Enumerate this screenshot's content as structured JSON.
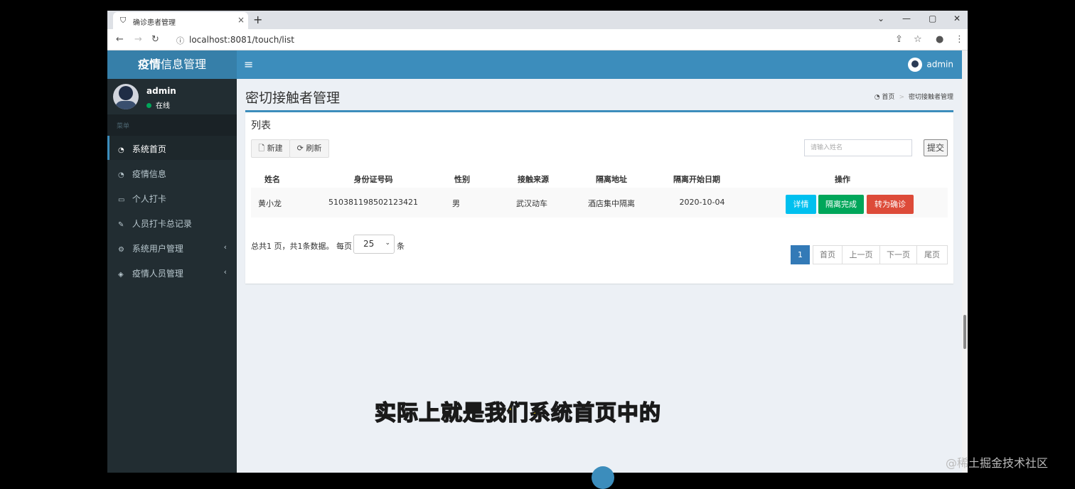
{
  "browser": {
    "tab_title": "确诊患者管理",
    "tab_icon": "shield-icon",
    "new_tab": "+",
    "close_tab": "×",
    "url": "localhost:8081/touch/list",
    "win_min": "—",
    "win_max": "▢",
    "win_close": "✕",
    "win_dropdown": "⌄"
  },
  "app": {
    "logo_bold": "疫情",
    "logo_rest": "信息管理",
    "top_user": "admin",
    "toggle": "≡"
  },
  "sidebar": {
    "user_name": "admin",
    "user_status": "在线",
    "menu_header": "菜单",
    "items": [
      {
        "label": "系统首页",
        "icon": "dashboard-icon",
        "glyph": "◔"
      },
      {
        "label": "疫情信息",
        "icon": "dashboard-icon",
        "glyph": "◔"
      },
      {
        "label": "个人打卡",
        "icon": "laptop-icon",
        "glyph": "▭"
      },
      {
        "label": "人员打卡总记录",
        "icon": "edit-icon",
        "glyph": "✎"
      },
      {
        "label": "系统用户管理",
        "icon": "cogs-icon",
        "glyph": "⚙"
      },
      {
        "label": "疫情人员管理",
        "icon": "cube-icon",
        "glyph": "◈"
      }
    ]
  },
  "content": {
    "page_title": "密切接触者管理",
    "breadcrumb_home": "首页",
    "breadcrumb_current": "密切接触者管理",
    "box_title": "列表",
    "btn_new": "新建",
    "btn_refresh": "刷新",
    "search_placeholder": "请输入姓名",
    "btn_submit": "提交",
    "columns": [
      "姓名",
      "身份证号码",
      "性别",
      "接触来源",
      "隔离地址",
      "隔离开始日期",
      "操作"
    ],
    "rows": [
      {
        "name": "黄小龙",
        "id": "510381198502123421",
        "gender": "男",
        "source": "武汉动车",
        "address": "酒店集中隔离",
        "date": "2020-10-04"
      }
    ],
    "actions": {
      "detail": "详情",
      "complete": "隔离完成",
      "confirm": "转为确诊"
    },
    "pagination": {
      "info": "总共1 页，共1条数据。 每页",
      "per_page": "25",
      "unit": "条",
      "current": "1",
      "first": "首页",
      "prev": "上一页",
      "next": "下一页",
      "last": "尾页"
    }
  },
  "overlay": {
    "subtitle": "实际上就是我们系统首页中的",
    "watermark": "@稀土掘金技术社区"
  },
  "colors": {
    "primary": "#3c8dbc",
    "logo_bg": "#367fa9",
    "sidebar_bg": "#222d32",
    "info": "#00c0ef",
    "success": "#00a65a",
    "danger": "#dd4b39"
  }
}
